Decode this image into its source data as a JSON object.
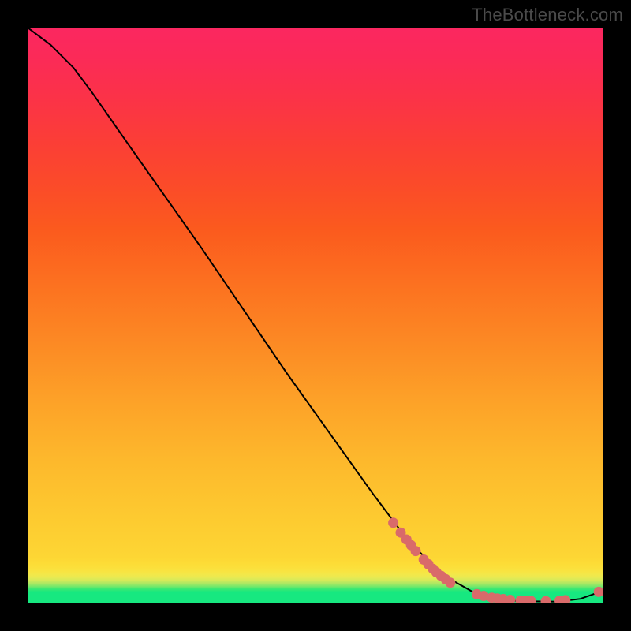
{
  "watermark": "TheBottleneck.com",
  "colors": {
    "dot": "#d96a6a",
    "curve": "#000000",
    "frame": "#000000"
  },
  "chart_data": {
    "type": "line",
    "title": "",
    "xlabel": "",
    "ylabel": "",
    "xlim": [
      0,
      100
    ],
    "ylim": [
      0,
      100
    ],
    "grid": false,
    "legend": false,
    "curve_points": [
      {
        "x": 0.0,
        "y": 100.0
      },
      {
        "x": 4.0,
        "y": 97.0
      },
      {
        "x": 8.0,
        "y": 93.0
      },
      {
        "x": 11.0,
        "y": 89.0
      },
      {
        "x": 18.0,
        "y": 79.0
      },
      {
        "x": 30.0,
        "y": 62.0
      },
      {
        "x": 45.0,
        "y": 40.0
      },
      {
        "x": 60.0,
        "y": 19.0
      },
      {
        "x": 66.0,
        "y": 11.0
      },
      {
        "x": 72.0,
        "y": 5.0
      },
      {
        "x": 78.0,
        "y": 1.6
      },
      {
        "x": 85.0,
        "y": 0.4
      },
      {
        "x": 92.0,
        "y": 0.3
      },
      {
        "x": 96.0,
        "y": 0.8
      },
      {
        "x": 100.0,
        "y": 2.2
      }
    ],
    "markers": [
      {
        "x": 63.5,
        "y": 14.0
      },
      {
        "x": 64.8,
        "y": 12.3
      },
      {
        "x": 65.8,
        "y": 11.1
      },
      {
        "x": 66.6,
        "y": 10.1
      },
      {
        "x": 67.4,
        "y": 9.1
      },
      {
        "x": 68.8,
        "y": 7.6
      },
      {
        "x": 69.6,
        "y": 6.8
      },
      {
        "x": 70.4,
        "y": 6.0
      },
      {
        "x": 71.0,
        "y": 5.4
      },
      {
        "x": 71.8,
        "y": 4.8
      },
      {
        "x": 72.6,
        "y": 4.2
      },
      {
        "x": 73.4,
        "y": 3.6
      },
      {
        "x": 78.0,
        "y": 1.6
      },
      {
        "x": 79.2,
        "y": 1.3
      },
      {
        "x": 80.6,
        "y": 1.0
      },
      {
        "x": 81.6,
        "y": 0.85
      },
      {
        "x": 82.6,
        "y": 0.75
      },
      {
        "x": 83.8,
        "y": 0.62
      },
      {
        "x": 85.6,
        "y": 0.5
      },
      {
        "x": 86.5,
        "y": 0.46
      },
      {
        "x": 87.4,
        "y": 0.44
      },
      {
        "x": 90.0,
        "y": 0.4
      },
      {
        "x": 92.4,
        "y": 0.48
      },
      {
        "x": 93.4,
        "y": 0.56
      },
      {
        "x": 99.2,
        "y": 2.0
      }
    ]
  }
}
